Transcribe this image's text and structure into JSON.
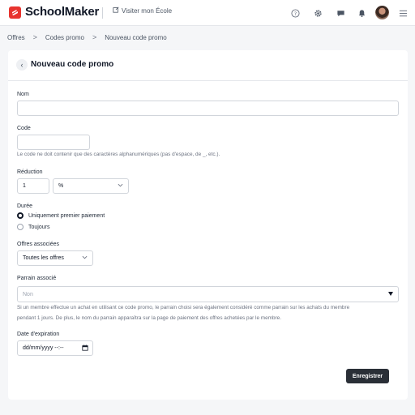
{
  "app": {
    "brand": "SchoolMaker",
    "visit_label": "Visiter mon École"
  },
  "header_icons": [
    "help-circle-icon",
    "gear-icon",
    "chat-icon",
    "bell-icon",
    "avatar",
    "hamburger-menu-icon"
  ],
  "breadcrumb": {
    "items": [
      "Offres",
      "Codes promo",
      "Nouveau code promo"
    ],
    "separator": ">"
  },
  "page": {
    "title": "Nouveau code promo",
    "back_glyph": "‹"
  },
  "form": {
    "nom": {
      "label": "Nom",
      "value": ""
    },
    "code": {
      "label": "Code",
      "value": "",
      "help": "Le code ne doit contenir que des caractères alphanumériques (pas d'espace, de _, etc.)."
    },
    "reduction": {
      "label": "Réduction",
      "value": "1",
      "unit": "%"
    },
    "duree": {
      "label": "Durée",
      "options": [
        "Uniquement premier paiement",
        "Toujours"
      ],
      "selected": "Uniquement premier paiement"
    },
    "offres": {
      "label": "Offres associées",
      "value": "Toutes les offres"
    },
    "parrain": {
      "label": "Parrain associé",
      "value": "Non",
      "help_line1": "Si un membre effectue un achat en utilisant ce code promo, le parrain choisi sera également considéré comme parrain sur les achats du membre",
      "help_line2": "pendant 1 jours. De plus, le nom du parrain apparaîtra sur la page de paiement des offres achetées par le membre."
    },
    "expiration": {
      "label": "Date d'expiration",
      "placeholder": "dd/mm/yyyy --:--"
    },
    "submit_label": "Enregistrer"
  },
  "colors": {
    "brand": "#e8342f",
    "primary_button": "#2a2f37",
    "background": "#f5f6f8"
  }
}
